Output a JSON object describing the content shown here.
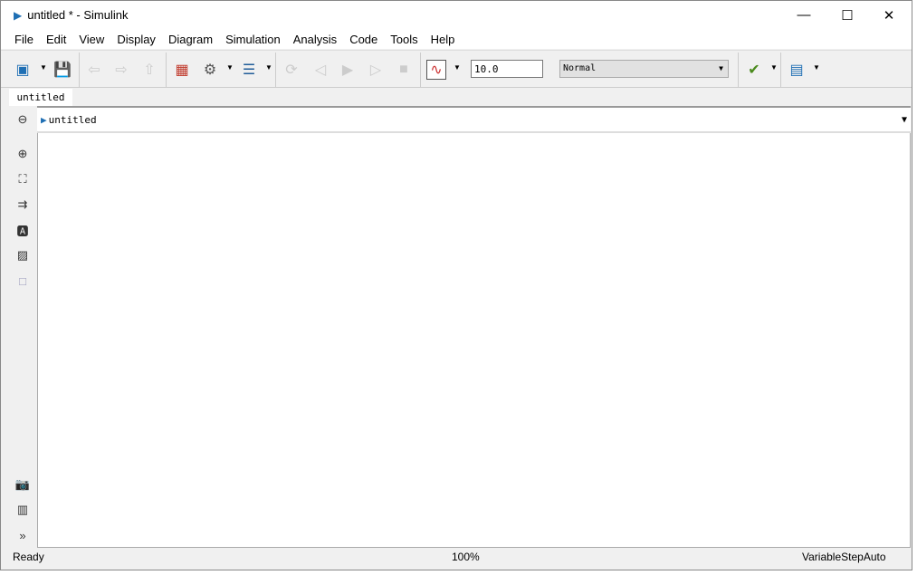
{
  "window": {
    "title": "untitled * - Simulink"
  },
  "menu": [
    "File",
    "Edit",
    "View",
    "Display",
    "Diagram",
    "Simulation",
    "Analysis",
    "Code",
    "Tools",
    "Help"
  ],
  "toolbar": {
    "stop_time": "10.0",
    "sim_mode": "Normal"
  },
  "tab": {
    "label": "untitled"
  },
  "address": {
    "path": "untitled"
  },
  "status": {
    "state": "Ready",
    "zoom": "100%",
    "solver": "VariableStepAuto"
  }
}
